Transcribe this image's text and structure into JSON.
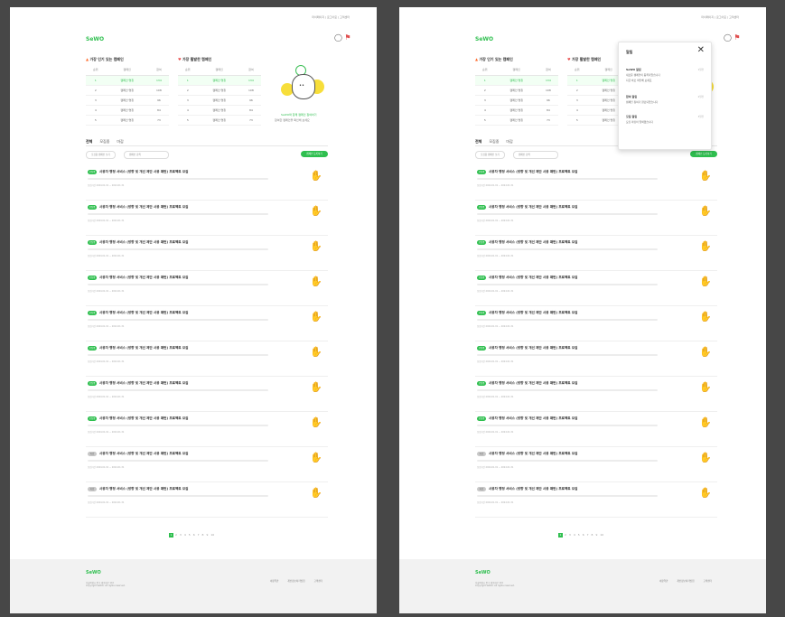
{
  "colors": {
    "background": "#474747",
    "accent": "#2fbf4f",
    "alert": "#e05050"
  },
  "header": {
    "top_nav": "마이페이지 | 로그아웃 | 고객센터",
    "logo": "SeWO",
    "icons": [
      "chat-icon",
      "bell-icon"
    ]
  },
  "rankings": {
    "left_title": "가장 인기 있는 캠페인",
    "right_title": "가장 활발한 캠페인",
    "columns": [
      "순위",
      "캠페인",
      "참여"
    ],
    "rows": [
      {
        "rank": "1",
        "name": "캠페인 명칭",
        "value": "134"
      },
      {
        "rank": "2",
        "name": "캠페인 명칭",
        "value": "108"
      },
      {
        "rank": "3",
        "name": "캠페인 명칭",
        "value": "96"
      },
      {
        "rank": "4",
        "name": "캠페인 명칭",
        "value": "84"
      },
      {
        "rank": "5",
        "name": "캠페인 명칭",
        "value": "73"
      }
    ]
  },
  "promo": {
    "line1": "SeWO와 함께 캠페인 참여하기",
    "line2": "참여한 캠페인을 확인해 보세요"
  },
  "tabs": [
    "전체",
    "모집중",
    "마감"
  ],
  "filters": {
    "status": "모집중 캠페인 보기",
    "search": "캠페인 검색"
  },
  "create_button": "캠페인 등록하기",
  "items": [
    {
      "tag": "모집중",
      "title": "사용자 행정 서비스 (방향 및 개선 제안 사용 패턴) 프로젝트 모집",
      "meta": "모집기간 2024.01.01 ~ 2024.01.31",
      "closed": false
    },
    {
      "tag": "모집중",
      "title": "사용자 행정 서비스 (방향 및 개선 제안 사용 패턴) 프로젝트 모집",
      "meta": "모집기간 2024.01.01 ~ 2024.01.31",
      "closed": false
    },
    {
      "tag": "모집중",
      "title": "사용자 행정 서비스 (방향 및 개선 제안 사용 패턴) 프로젝트 모집",
      "meta": "모집기간 2024.01.01 ~ 2024.01.31",
      "closed": false
    },
    {
      "tag": "모집중",
      "title": "사용자 행정 서비스 (방향 및 개선 제안 사용 패턴) 프로젝트 모집",
      "meta": "모집기간 2024.01.01 ~ 2024.01.31",
      "closed": false
    },
    {
      "tag": "모집중",
      "title": "사용자 행정 서비스 (방향 및 개선 제안 사용 패턴) 프로젝트 모집",
      "meta": "모집기간 2024.01.01 ~ 2024.01.31",
      "closed": false
    },
    {
      "tag": "모집중",
      "title": "사용자 행정 서비스 (방향 및 개선 제안 사용 패턴) 프로젝트 모집",
      "meta": "모집기간 2024.01.01 ~ 2024.01.31",
      "closed": false
    },
    {
      "tag": "모집중",
      "title": "사용자 행정 서비스 (방향 및 개선 제안 사용 패턴) 프로젝트 모집",
      "meta": "모집기간 2024.01.01 ~ 2024.01.31",
      "closed": false
    },
    {
      "tag": "모집중",
      "title": "사용자 행정 서비스 (방향 및 개선 제안 사용 패턴) 프로젝트 모집",
      "meta": "모집기간 2024.01.01 ~ 2024.01.31",
      "closed": false
    },
    {
      "tag": "마감",
      "title": "사용자 행정 서비스 (방향 및 개선 제안 사용 패턴) 프로젝트 모집",
      "meta": "모집기간 2024.01.01 ~ 2024.01.31",
      "closed": true
    },
    {
      "tag": "마감",
      "title": "사용자 행정 서비스 (방향 및 개선 제안 사용 패턴) 프로젝트 모집",
      "meta": "모집기간 2024.01.01 ~ 2024.01.31",
      "closed": true
    }
  ],
  "pagination": {
    "current": "1",
    "pages": [
      "2",
      "3",
      "4",
      "5",
      "6",
      "7",
      "8",
      "9",
      "10"
    ]
  },
  "footer": {
    "logo": "SeWO",
    "address1": "서울특별시 중구 세종대로 110",
    "address2": "Copyright SeWO. All rights reserved.",
    "links": [
      "이용약관",
      "개인정보처리방침",
      "고객센터"
    ]
  },
  "notification_panel": {
    "title": "알림",
    "close_icon": "close-icon",
    "items": [
      {
        "title": "SeWO 알림",
        "line1": "새로운 캠페인이 등록되었습니다",
        "line2": "지금 바로 확인해 보세요",
        "time": "1일전"
      },
      {
        "title": "참여 알림",
        "line1": "캠페인 참여가 완료되었습니다",
        "line2": "",
        "time": "2일전"
      },
      {
        "title": "모집 알림",
        "line1": "모집 마감이 임박했습니다",
        "line2": "",
        "time": "3일전"
      }
    ]
  }
}
